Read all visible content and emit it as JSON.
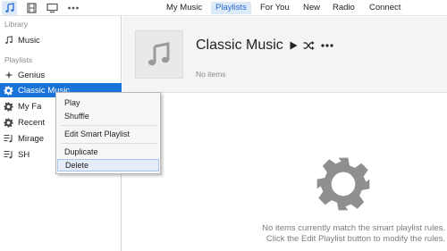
{
  "toolbar": {
    "media_icons": [
      "music-note-icon",
      "film-icon",
      "tv-icon",
      "more-icon"
    ],
    "nav_tabs": [
      "My Music",
      "Playlists",
      "For You",
      "New",
      "Radio",
      "Connect"
    ],
    "selected_tab": "Playlists"
  },
  "sidebar": {
    "library_heading": "Library",
    "library_items": [
      {
        "label": "Music",
        "icon": "music-note-icon"
      }
    ],
    "playlists_heading": "Playlists",
    "playlists": [
      {
        "label": "Genius",
        "icon": "genius-icon"
      },
      {
        "label": "Classic Music",
        "icon": "gear-icon",
        "selected": true
      },
      {
        "label": "My Fa",
        "icon": "gear-icon"
      },
      {
        "label": "Recent",
        "icon": "gear-icon"
      },
      {
        "label": "Mirage",
        "icon": "playlist-icon"
      },
      {
        "label": "SH",
        "icon": "playlist-icon"
      }
    ]
  },
  "playlist": {
    "title": "Classic Music",
    "subtitle": "No items",
    "artwork_icon": "music-note-icon",
    "controls": [
      "play-icon",
      "shuffle-icon",
      "more-icon"
    ]
  },
  "empty_state": {
    "icon": "gear-icon",
    "line1": "No items currently match the smart playlist rules.",
    "line2": "Click the Edit Playlist button to modify the rules."
  },
  "context_menu": {
    "items": [
      "Play",
      "Shuffle",
      "Edit Smart Playlist",
      "Duplicate",
      "Delete"
    ],
    "hovered": "Delete"
  },
  "colors": {
    "accent": "#1a73d9",
    "tab_selected_bg": "#dce9f7",
    "tab_selected_text": "#2a6bd8",
    "header_band": "#f4f4f4",
    "gear_gray": "#8f8f8f"
  }
}
